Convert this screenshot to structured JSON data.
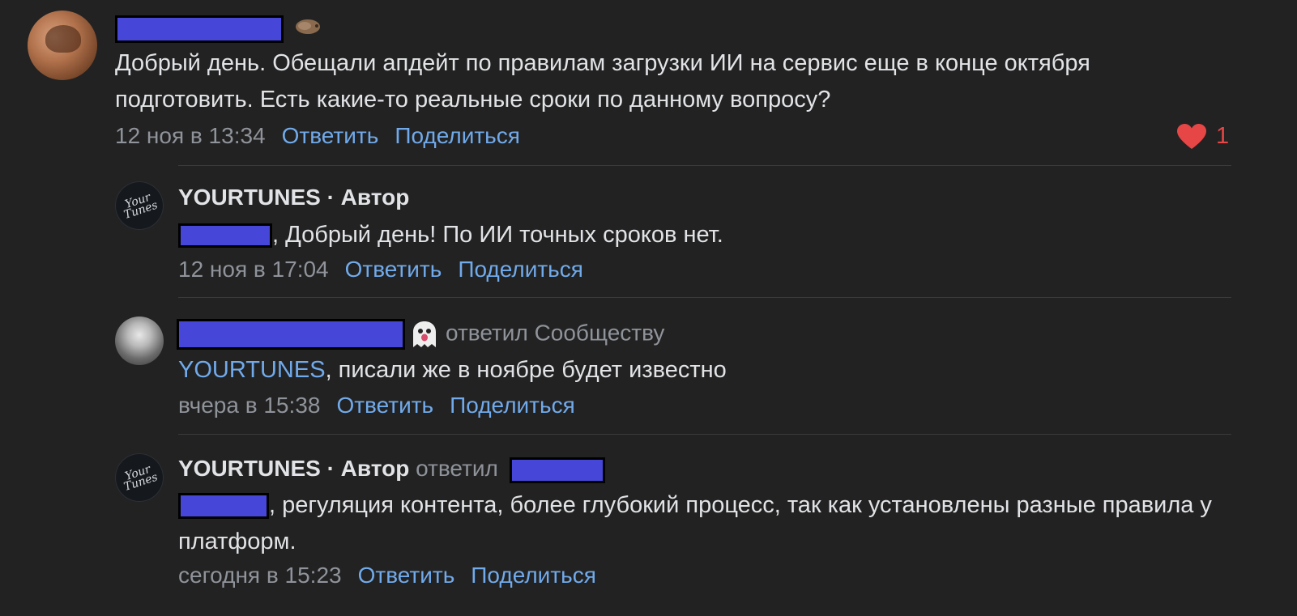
{
  "comments": [
    {
      "text": "Добрый день. Обещали апдейт по правилам загрузки ИИ на сервис еще в конце октября подготовить. Есть какие-то реальные сроки по данному вопросу?",
      "time": "12 ноя в 13:34",
      "reply": "Ответить",
      "share": "Поделиться",
      "likes": "1"
    }
  ],
  "replies": [
    {
      "author": "YOURTUNES",
      "role": "· Автор",
      "text": ", Добрый день! По ИИ точных сроков нет.",
      "time": "12 ноя в 17:04",
      "reply": "Ответить",
      "share": "Поделиться"
    },
    {
      "suffix": "ответил Сообществу",
      "mention": "YOURTUNES",
      "text": ", писали же в ноябре будет известно",
      "time": "вчера в 15:38",
      "reply": "Ответить",
      "share": "Поделиться"
    },
    {
      "author": "YOURTUNES",
      "role": "· Автор",
      "suffix": "ответил",
      "text": ", регуляция контента, более глубокий процесс, так как установлены разные правила у платформ.",
      "time": "сегодня в 15:23",
      "reply": "Ответить",
      "share": "Поделиться"
    }
  ],
  "colors": {
    "background": "#222222",
    "text": "#e1e3e6",
    "muted": "#8f939a",
    "link": "#71aaeb",
    "like": "#e64646",
    "redaction": "#4646d8"
  },
  "icons": {
    "like": "heart-icon",
    "status_emoji": "hedgehog-emoji-icon",
    "ghost_emoji": "ghost-emoji-icon"
  }
}
